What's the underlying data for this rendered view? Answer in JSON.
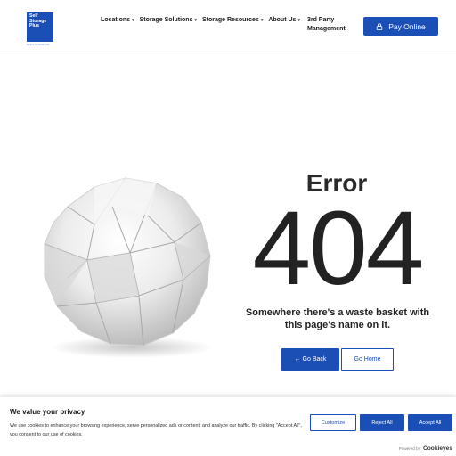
{
  "header": {
    "logo": {
      "line1": "Self",
      "line2": "Storage",
      "line3": "Plus",
      "tagline": "Space to Grow Life"
    },
    "nav": [
      {
        "label": "Locations",
        "has_dropdown": true
      },
      {
        "label": "Storage Solutions",
        "has_dropdown": true
      },
      {
        "label": "Storage Resources",
        "has_dropdown": true
      },
      {
        "label": "About Us",
        "has_dropdown": true
      }
    ],
    "nav_third": {
      "line1": "3rd Party",
      "line2": "Management"
    },
    "pay_button": "Pay Online",
    "pay_icon": "lock-icon"
  },
  "main": {
    "title": "Error",
    "code": "404",
    "message": "Somewhere there's a waste basket with this page's name on it.",
    "back_button": "← Go Back",
    "home_button": "Go Home",
    "image": "crumpled-paper-ball"
  },
  "cookie": {
    "title": "We value your privacy",
    "text": "We use cookies to enhance your browsing experience, serve personalized ads or content, and analyze our traffic. By clicking \"Accept All\", you consent to our use of cookies.",
    "customize": "Customize",
    "reject": "Reject All",
    "accept": "Accept All",
    "powered_by": "Powered by",
    "brand": "Cookieyes"
  },
  "colors": {
    "brand_blue": "#1b4fb6",
    "text_dark": "#222222"
  }
}
